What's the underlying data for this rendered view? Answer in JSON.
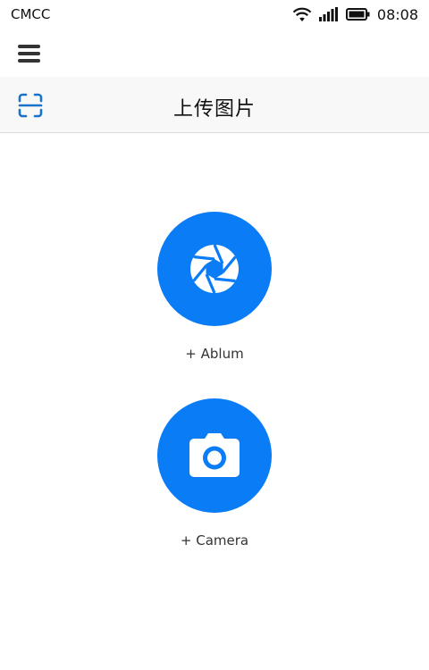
{
  "status_bar": {
    "carrier": "CMCC",
    "time": "08:08",
    "icons": [
      "wifi-icon",
      "signal-icon",
      "battery-icon"
    ]
  },
  "menu": {
    "icon": "hamburger-menu-icon"
  },
  "header": {
    "title": "上传图片",
    "scan_icon": "scan-icon"
  },
  "actions": {
    "album": {
      "label": "+ Ablum",
      "icon": "aperture-icon"
    },
    "camera": {
      "label": "+ Camera",
      "icon": "camera-icon"
    }
  },
  "colors": {
    "accent": "#0a7cf5",
    "header_bg": "#f8f8f8",
    "scan_icon": "#1a73c8"
  }
}
